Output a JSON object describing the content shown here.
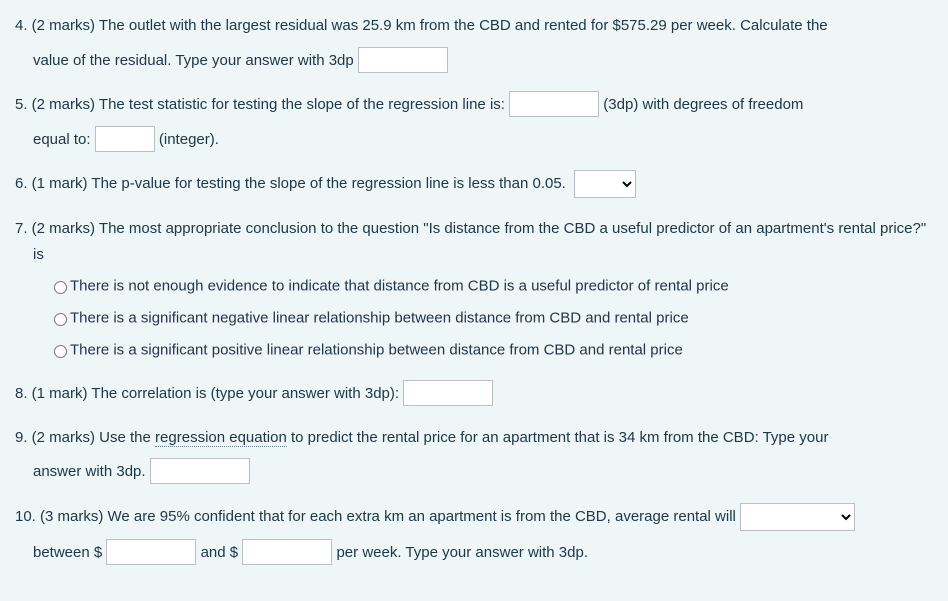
{
  "q4": {
    "text_a": "4. (2 marks) The outlet with the largest residual was 25.9 km from the CBD and rented for $575.29 per week. Calculate the",
    "text_b": "value of the residual. Type your answer with 3dp"
  },
  "q5": {
    "text_a": "5. (2 marks) The test statistic for testing the slope of the regression line is:",
    "text_b": "(3dp) with degrees of freedom",
    "text_c": "equal to:",
    "text_d": "(integer)."
  },
  "q6": {
    "text_a": "6. (1 mark) The p-value for testing the slope of the regression line is less than 0.05."
  },
  "q7": {
    "text_a": "7. (2 marks) The most appropriate conclusion to the question \"Is distance from the CBD a useful predictor of an apartment's rental price?\" is",
    "opt1": "There is not enough evidence to indicate that distance from CBD is a useful predictor of rental price",
    "opt2": "There is a significant negative linear relationship between distance from CBD and rental price",
    "opt3": "There is a significant positive linear relationship between distance from CBD and rental price"
  },
  "q8": {
    "text_a": "8. (1 mark) The correlation is (type your answer with 3dp):"
  },
  "q9": {
    "text_a": "9. (2 marks) Use the ",
    "text_underline": "regression equation",
    "text_b": " to predict the rental price for an apartment that is 34 km from the CBD: Type your",
    "text_c": "answer with 3dp."
  },
  "q10": {
    "text_a": "10. (3 marks) We are 95% confident that for each extra km an apartment is from the CBD, average rental will",
    "text_b": "between $",
    "text_c": "and $",
    "text_d": "per week. Type your answer with 3dp."
  }
}
